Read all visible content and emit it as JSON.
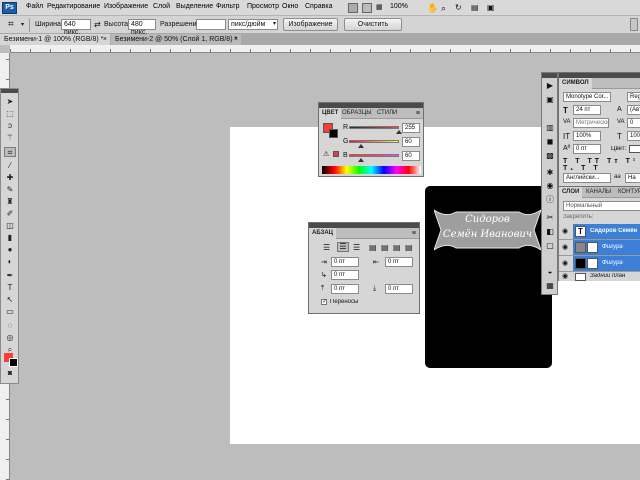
{
  "app": {
    "logo": "Ps",
    "menu": [
      "Файл",
      "Редактирование",
      "Изображение",
      "Слой",
      "Выделение",
      "Фильтр",
      "Просмотр",
      "Окно",
      "Справка"
    ],
    "zoom": "100%"
  },
  "options": {
    "width_label": "Ширина:",
    "width_value": "640 пикс.",
    "height_label": "Высота:",
    "height_value": "480 пикс.",
    "resolution_label": "Разрешение:",
    "resolution_value": "",
    "resolution_unit": "пикс/дюйм",
    "image_button": "Изображение",
    "clear_button": "Очистить"
  },
  "documents": {
    "tab1": "Безимени-1 @ 100% (RGB/8) *",
    "tab2": "Безимени-2 @ 50% (Слой 1, RGB/8) *"
  },
  "color_panel": {
    "tabs": [
      "ЦВЕТ",
      "ОБРАЗЦЫ",
      "СТИЛИ"
    ],
    "r_label": "R",
    "r_value": "255",
    "g_label": "G",
    "g_value": "60",
    "b_label": "B",
    "b_value": "60",
    "foreground": "#ff3c3c",
    "background": "#000000"
  },
  "paragraph_panel": {
    "tab": "АБЗАЦ",
    "indent_left": "0 пт",
    "indent_right": "0 пт",
    "indent_first": "0 пт",
    "space_before": "0 пт",
    "space_after": "0 пт",
    "hyphenation": "Переносы"
  },
  "character_panel": {
    "tab": "СИМВОЛ",
    "font_family": "Monotype Cor...",
    "font_style": "Reg",
    "font_size": "24 пт",
    "leading": "(Авто)",
    "kerning": "Метрически",
    "tracking": "0",
    "scale_v": "100%",
    "scale_h": "100%",
    "baseline": "0 пт",
    "color_label": "Цвет:",
    "language": "Английски...",
    "aa_label": "aa",
    "aa_value": "На"
  },
  "layers_panel": {
    "tabs": [
      "СЛОИ",
      "КАНАЛЫ",
      "КОНТУРЫ"
    ],
    "blend_mode": "Нормальный",
    "lock_label": "Закрепить:",
    "layers": [
      {
        "name": "Сидоров Семён",
        "type": "text",
        "selected": true
      },
      {
        "name": "Фигура",
        "type": "shape",
        "selected": true
      },
      {
        "name": "Фигура",
        "type": "shape",
        "selected": true
      },
      {
        "name": "Задний план",
        "type": "background",
        "selected": false
      }
    ]
  },
  "card": {
    "line1": "Сидоров",
    "line2": "Семён Иванович"
  },
  "colors": {
    "ribbon": "#9e9e9e",
    "selection": "#3d7fd6",
    "card": "#000000"
  }
}
